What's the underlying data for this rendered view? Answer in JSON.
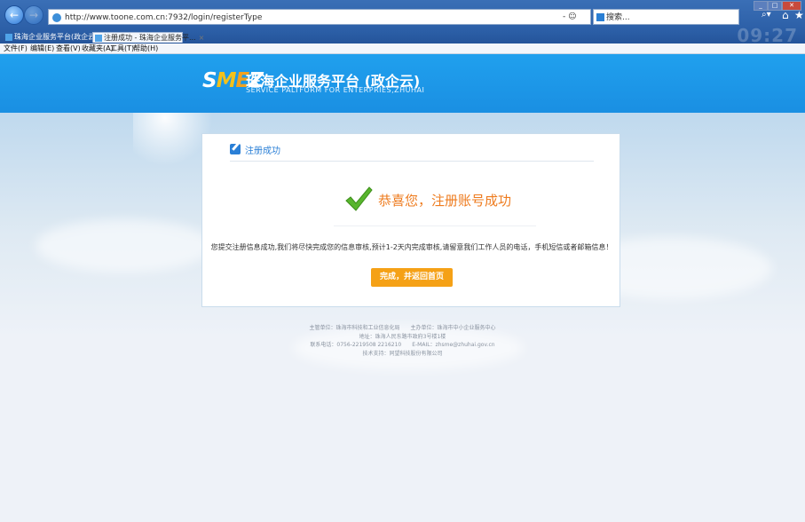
{
  "browser": {
    "address_url": "http://www.toone.com.cn:7932/login/registerType",
    "address_refresh": "- ☺",
    "search_placeholder": "搜索...",
    "tabs": [
      {
        "label": "珠海企业服务平台(政企云)"
      },
      {
        "label": "注册成功 - 珠海企业服务平..."
      }
    ],
    "menu": [
      "文件(F)",
      "编辑(E)",
      "查看(V)",
      "收藏夹(A)",
      "工具(T)",
      "帮助(H)"
    ],
    "clock": "09:27"
  },
  "site": {
    "logo_mark": "SMEZ",
    "title": "珠海企业服务平台 (政企云)",
    "subtitle": "SERVICE PALTFORM FOR ENTERPRIES,ZHUHAI"
  },
  "card": {
    "title": "注册成功",
    "success_message": "恭喜您，注册账号成功",
    "info": "您提交注册信息成功,我们将尽快完成您的信息审核,预计1-2天内完成审核,请留意我们工作人员的电话，手机短信或者邮箱信息！",
    "done_button": "完成，并返回首页"
  },
  "footer": {
    "line1": "主管单位：珠海市科技和工业信息化局　　主办单位：珠海市中小企业服务中心",
    "line2": "地址：珠海人民东路市政府3号楼1楼",
    "line3": "联系电话：0756-2219508 2216210　　E-MAIL：zhsme@zhuhai.gov.cn",
    "line4": "技术支持：同望科技股份有限公司"
  },
  "colors": {
    "banner": "#1a8fe2",
    "accent_orange": "#f5a116",
    "success_text": "#ee7b1e",
    "title_blue": "#2a7fd6"
  }
}
